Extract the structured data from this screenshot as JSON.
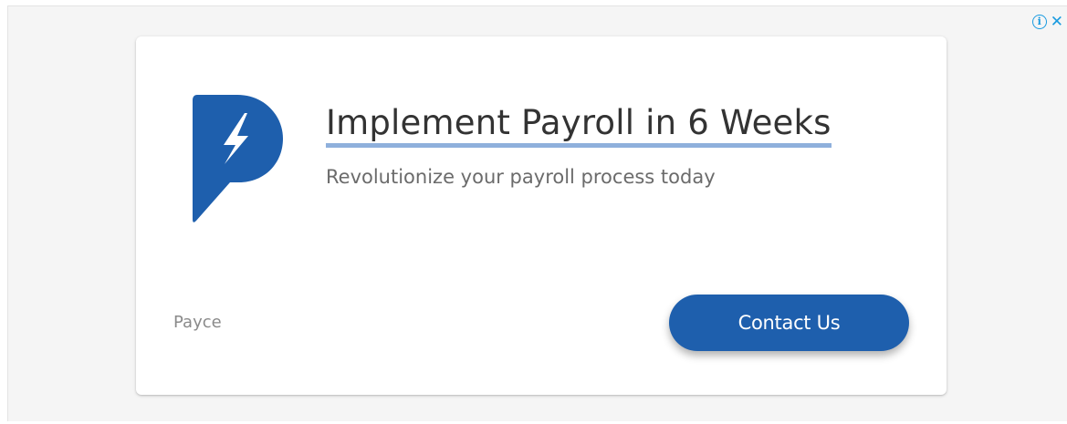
{
  "ad": {
    "headline": "Implement Payroll in 6 Weeks",
    "description": "Revolutionize your payroll process today",
    "advertiser": "Payce",
    "cta_label": "Contact Us",
    "logo_icon": "payce-logo-icon",
    "adchoices": {
      "info_icon": "info-icon",
      "info_glyph": "i",
      "close_icon": "close-icon",
      "close_glyph": "✕"
    },
    "colors": {
      "brand_blue": "#1e5fad",
      "headline_underline": "#8fb0dc",
      "adchoices_blue": "#1a9be0"
    }
  }
}
